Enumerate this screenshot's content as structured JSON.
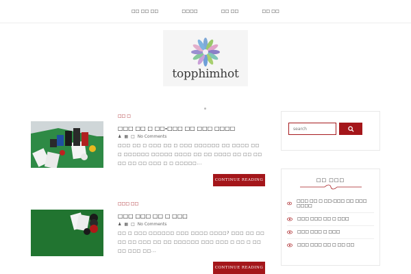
{
  "nav": {
    "items": [
      {
        "label": "□□ □□ □□"
      },
      {
        "label": "□□□□"
      },
      {
        "label": "□□ □□"
      },
      {
        "label": "□□ □□"
      }
    ]
  },
  "logo": {
    "text": "topphimhot"
  },
  "posts": [
    {
      "category": "□□ □",
      "title": "□□□ □□ □ □□-□□□ □□ □□□ □□□□",
      "author_icon": "user-icon",
      "comments": "No Comments",
      "excerpt": "□□□ □□ □ □□□ □□ □ □□□ □□□□□□ □□ □□□□ □□ □ □□□□□□ □□□□□ □□□□ □□ □□ □□□□ □□ □□ □□ □□ □□ □□ □□□ □ □ □□□□□...",
      "button": "CONTINUE READING"
    },
    {
      "category": "□□□ □□",
      "title": "□□□ □□□ □□ □ □□□",
      "author_icon": "user-icon",
      "comments": "No Comments",
      "excerpt": "□□ □ □□□ □□□□□□ □□□ □□□□ □□□□? □□□ □□ □□ □□ □□ □□□ □□ □□ □□□□□□ □□□ □□□ □ □□ □ □□ □□ □□□ □□...",
      "button": "CONTINUE READING"
    }
  ],
  "sidebar": {
    "search": {
      "placeholder": "search"
    },
    "recent": {
      "title": "□□ □□□",
      "items": [
        {
          "label": "□□□ □□ □ □□-□□□ □□ □□□ □□□□"
        },
        {
          "label": "□□□ □□□ □□ □ □□□"
        },
        {
          "label": "□□□ □□□ □ □□□"
        },
        {
          "label": "□□□ □□□ □□ □ □□ □□"
        }
      ]
    }
  },
  "colors": {
    "accent": "#a4161a",
    "border": "#e8e8e8",
    "text": "#222222"
  }
}
